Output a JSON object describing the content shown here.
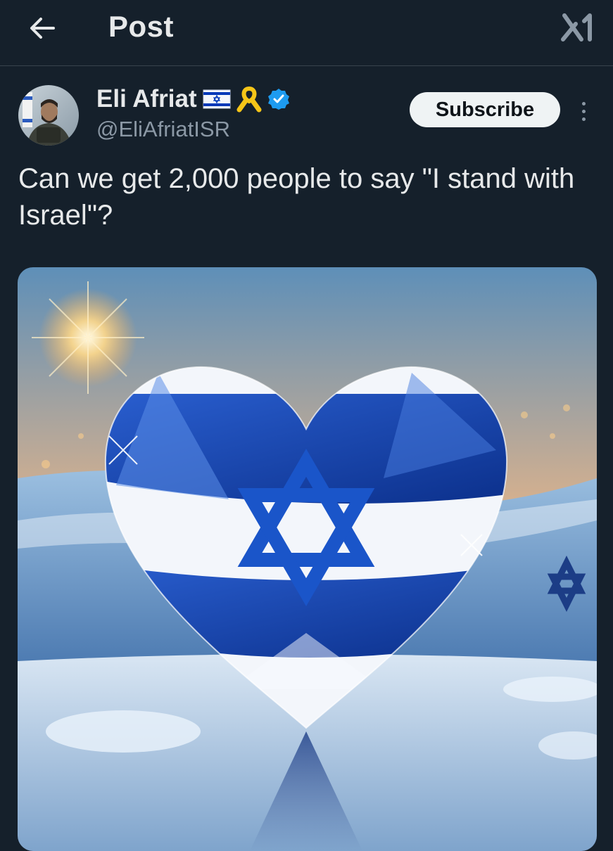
{
  "header": {
    "title": "Post",
    "back_icon": "arrow-left-icon",
    "logo_icon": "x-logo-icon"
  },
  "post": {
    "author": {
      "name": "Eli Afriat",
      "handle": "@EliAfriatISR",
      "badges": [
        "israel-flag-icon",
        "yellow-ribbon-icon",
        "verified-badge-icon"
      ]
    },
    "subscribe_label": "Subscribe",
    "more_icon": "more-dots-icon",
    "text": "Can we get 2,000 people to say \"I stand with Israel\"?",
    "media": {
      "description_icon": "heart-flag-image"
    }
  },
  "colors": {
    "background": "#15202b",
    "text_primary": "#e7e9ea",
    "text_secondary": "#8b98a5",
    "verified_blue": "#1d9bf0",
    "flag_blue": "#0038b8"
  }
}
